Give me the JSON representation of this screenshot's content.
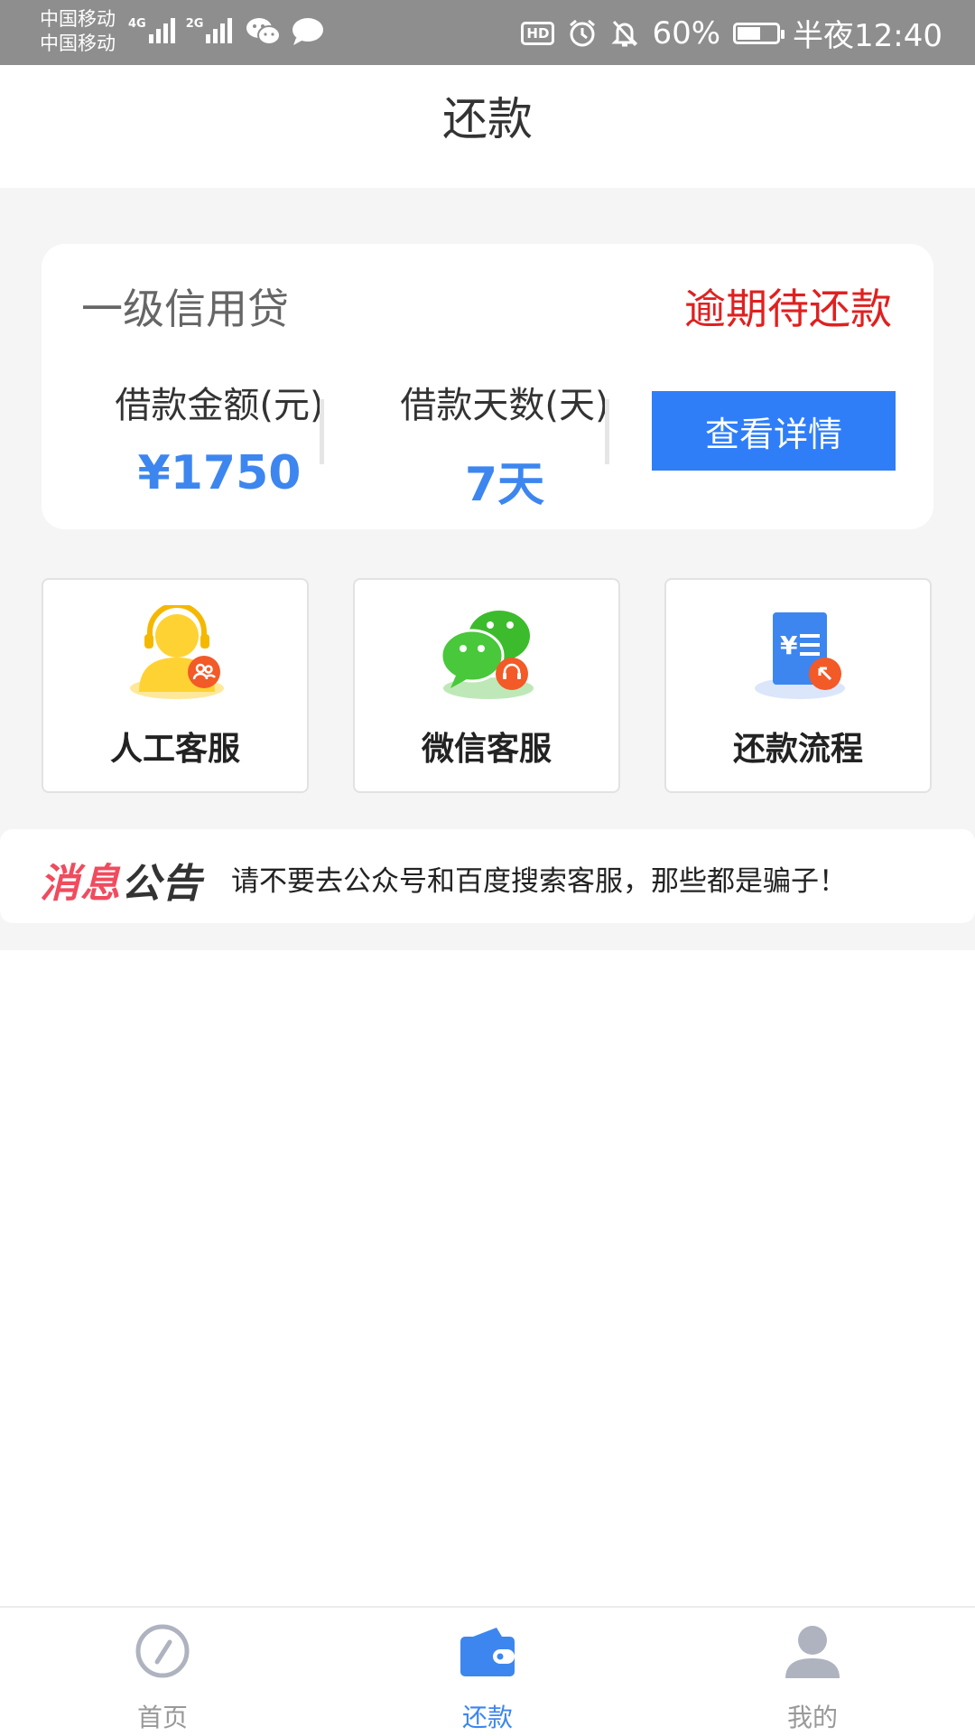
{
  "status_bar": {
    "carrier_1": "中国移动",
    "carrier_2": "中国移动",
    "net_1": "4G",
    "net_2": "2G",
    "hd_badge": "HD",
    "battery_percent": "60%",
    "battery_level": 0.6,
    "time": "半夜12:40"
  },
  "header": {
    "title": "还款"
  },
  "loan_card": {
    "product_name": "一级信用贷",
    "status": "逾期待还款",
    "amount_label": "借款金额(元)",
    "amount_value": "¥1750",
    "days_label": "借款天数(天)",
    "days_value": "7天",
    "detail_button": "查看详情"
  },
  "services": [
    {
      "label": "人工客服",
      "icon": "customer-service-icon"
    },
    {
      "label": "微信客服",
      "icon": "wechat-service-icon"
    },
    {
      "label": "还款流程",
      "icon": "repayment-process-icon"
    }
  ],
  "notice": {
    "logo_part1": "消息",
    "logo_part2": "公告",
    "text": "请不要去公众号和百度搜索客服，那些都是骗子！"
  },
  "tabbar": {
    "items": [
      {
        "label": "首页",
        "icon": "compass-icon",
        "active": false
      },
      {
        "label": "还款",
        "icon": "wallet-icon",
        "active": true
      },
      {
        "label": "我的",
        "icon": "user-icon",
        "active": false
      }
    ]
  },
  "colors": {
    "accent": "#2f7ef8",
    "value_blue": "#3d86ef",
    "overdue_red": "#e02020",
    "tab_inactive": "#999999",
    "background_gray": "#f5f5f5"
  }
}
